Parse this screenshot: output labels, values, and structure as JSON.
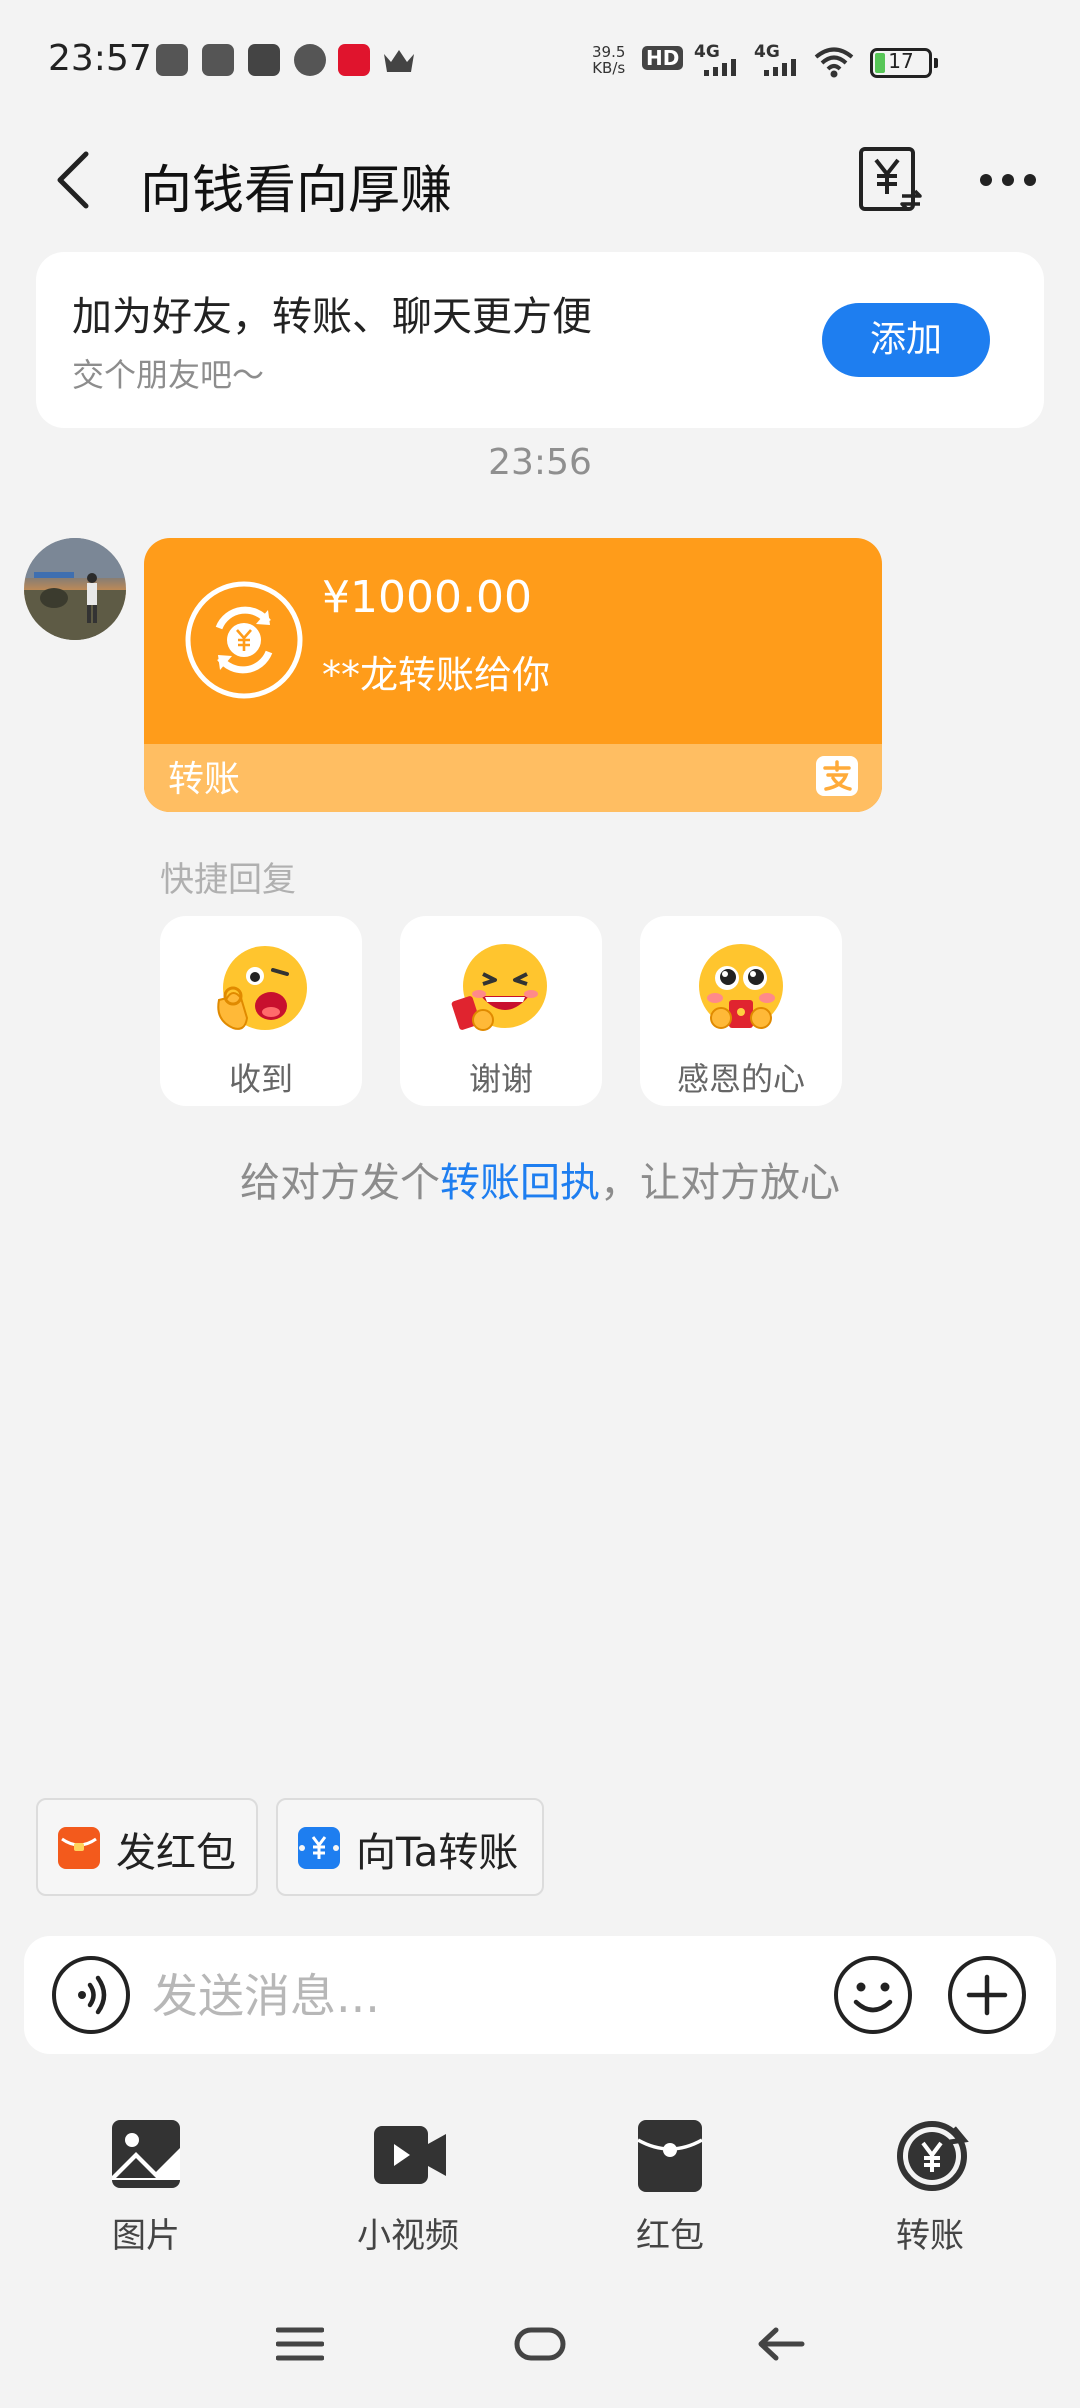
{
  "status_bar": {
    "time": "23:57",
    "net_speed_value": "39.5",
    "net_speed_unit": "KB/s",
    "hd_label": "HD",
    "signal_1": "4G",
    "signal_2": "4G",
    "battery": "17",
    "icons": [
      "app-icon-1",
      "vivo-icon",
      "k-icon",
      "mobile-icon",
      "unicom-icon",
      "crown-icon"
    ]
  },
  "header": {
    "title": "向钱看向厚赚"
  },
  "friend_banner": {
    "title": "加为好友，转账、聊天更方便",
    "subtitle": "交个朋友吧～",
    "button": "添加"
  },
  "chat": {
    "timestamp": "23:56",
    "transfer": {
      "amount": "¥1000.00",
      "from_text": "**龙转账给你",
      "footer_label": "转账"
    },
    "quick_reply_label": "快捷回复",
    "quick_replies": [
      "收到",
      "谢谢",
      "感恩的心"
    ],
    "receipt_tip": {
      "before": "给对方发个",
      "link": "转账回执",
      "after": "，让对方放心"
    }
  },
  "quick_actions": {
    "red_packet": "发红包",
    "transfer_to": "向Ta转账"
  },
  "composer": {
    "placeholder": "发送消息..."
  },
  "tools": [
    "图片",
    "小视频",
    "红包",
    "转账"
  ],
  "colors": {
    "accent_blue": "#1e7ef0",
    "transfer_orange": "#ff9c1a",
    "transfer_footer": "#ffbe62",
    "background": "#f3f3f3"
  }
}
